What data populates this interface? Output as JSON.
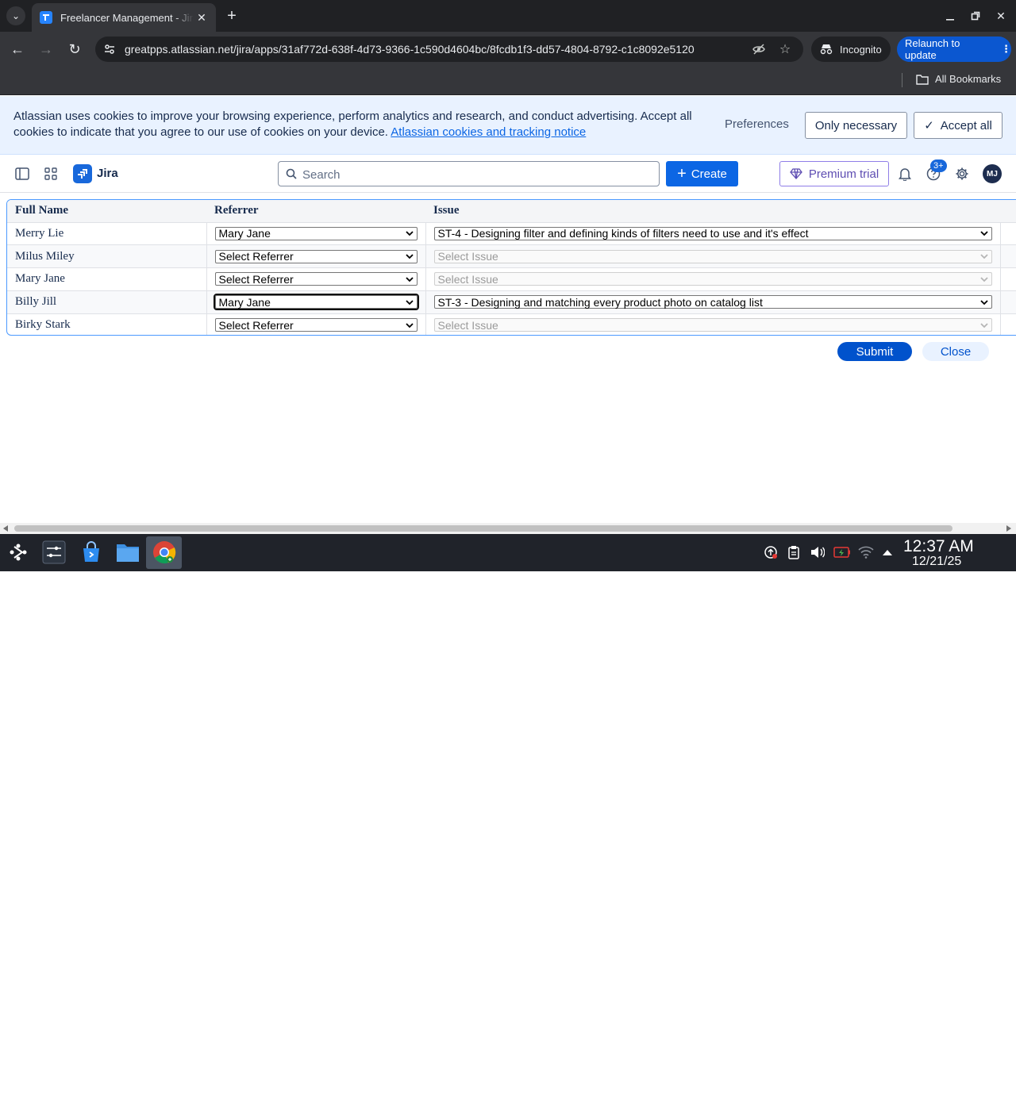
{
  "browser": {
    "tab_title": "Freelancer Management - Jira",
    "url": "greatpps.atlassian.net/jira/apps/31af772d-638f-4d73-9366-1c590d4604bc/8fcdb1f3-dd57-4804-8792-c1c8092e5120",
    "incognito_label": "Incognito",
    "relaunch_label": "Relaunch to update",
    "all_bookmarks_label": "All Bookmarks"
  },
  "cookie_banner": {
    "text": "Atlassian uses cookies to improve your browsing experience, perform analytics and research, and conduct advertising. Accept all cookies to indicate that you agree to our use of cookies on your device.",
    "link_text": "Atlassian cookies and tracking notice",
    "preferences_label": "Preferences",
    "only_necessary_label": "Only necessary",
    "accept_all_label": "Accept all"
  },
  "jira_nav": {
    "app_name": "Jira",
    "search_placeholder": "Search",
    "create_label": "Create",
    "premium_label": "Premium trial",
    "help_badge": "3+",
    "avatar_initials": "MJ",
    "brand_color": "#1868db"
  },
  "table": {
    "headers": [
      "Full Name",
      "Referrer",
      "Issue"
    ],
    "rows": [
      {
        "name": "Merry Lie",
        "referrer": "Mary Jane",
        "issue": "ST-4 - Designing filter and defining kinds of filters need to use and it's effect"
      },
      {
        "name": "Milus Miley",
        "referrer": "Select Referrer",
        "issue": "Select Issue"
      },
      {
        "name": "Mary Jane",
        "referrer": "Select Referrer",
        "issue": "Select Issue"
      },
      {
        "name": "Billy Jill",
        "referrer": "Mary Jane",
        "issue": "ST-3 - Designing and matching every product photo on catalog list"
      },
      {
        "name": "Birky Stark",
        "referrer": "Select Referrer",
        "issue": "Select Issue"
      }
    ]
  },
  "actions": {
    "submit_label": "Submit",
    "close_label": "Close"
  },
  "taskbar": {
    "time": "12:37 AM",
    "date": "12/21/25"
  }
}
